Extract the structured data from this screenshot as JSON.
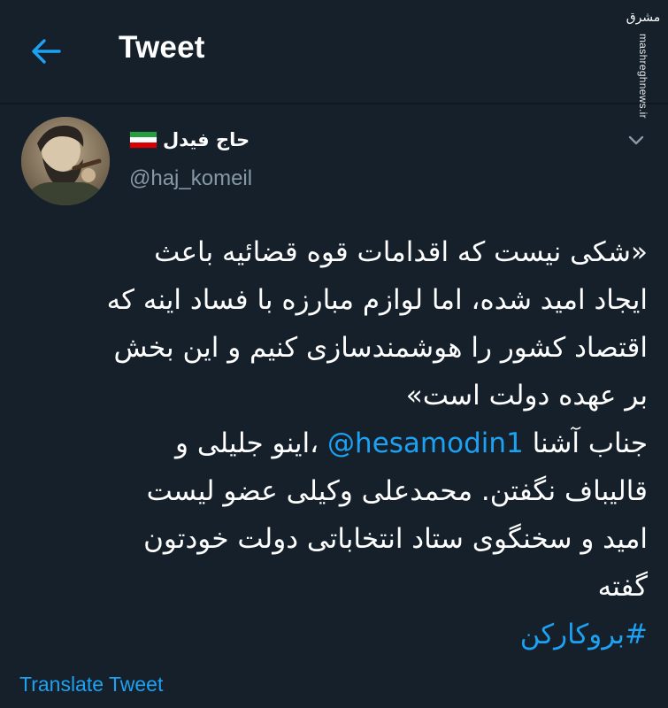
{
  "header": {
    "title": "Tweet",
    "back_icon": "arrow-left-icon",
    "accent_color": "#1da1f2"
  },
  "watermark": {
    "logo_text": "مشرق",
    "url": "mashreghnews.ir"
  },
  "author": {
    "display_name": "حاج فیدل",
    "handle": "@haj_komeil",
    "flag_icon": "iran-flag-icon",
    "menu_icon": "chevron-down-icon"
  },
  "tweet": {
    "line1": "«شکی نیست که اقدامات قوه قضائیه باعث",
    "line2": "ایجاد امید شده، اما لوازم مبارزه با فساد اینه که",
    "line3": "اقتصاد کشور را هوشمندسازی کنیم و این بخش",
    "line4": "بر عهده دولت است»",
    "line5_before": "جناب آشنا",
    "mention": "@hesamodin1",
    "line5_after": "،اینو جلیلی و",
    "line6": "قالیباف نگفتن. محمدعلی وکیلی عضو لیست",
    "line7": "امید و سخنگوی ستاد انتخاباتی دولت خودتون",
    "line8": "گفته",
    "hashtag": "#بروکارکن"
  },
  "translate_label": "Translate Tweet",
  "colors": {
    "background": "#15202b",
    "secondary_text": "#8899a6",
    "link": "#1da1f2"
  }
}
